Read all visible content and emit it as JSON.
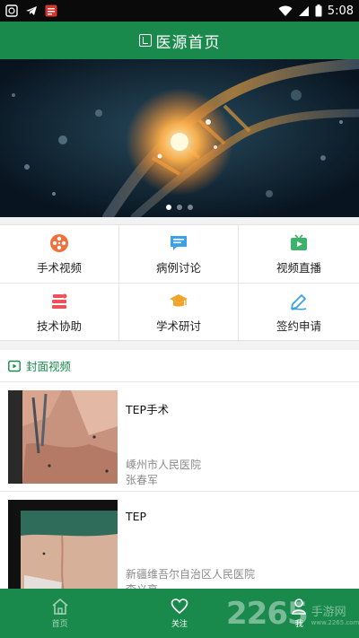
{
  "status_bar": {
    "time": "5:08",
    "icons": [
      "gallery-icon",
      "telegram-icon",
      "app-notification-icon",
      "wifi-icon",
      "signal-icon",
      "battery-icon"
    ]
  },
  "header": {
    "title": "医源首页"
  },
  "banner": {
    "slide_count": 3,
    "active_slide": 0
  },
  "features": [
    {
      "label": "手术视频",
      "icon": "film-reel-icon",
      "color": "#f0703c"
    },
    {
      "label": "病例讨论",
      "icon": "chat-bubble-icon",
      "color": "#3aa0e8"
    },
    {
      "label": "视频直播",
      "icon": "live-video-icon",
      "color": "#3cb26a"
    },
    {
      "label": "技术协助",
      "icon": "assist-stack-icon",
      "color": "#f0505a"
    },
    {
      "label": "学术研讨",
      "icon": "graduation-cap-icon",
      "color": "#f0a42a"
    },
    {
      "label": "签约申请",
      "icon": "signature-pen-icon",
      "color": "#3aa0e8"
    }
  ],
  "section": {
    "title": "封面视频",
    "icon": "video-play-icon"
  },
  "videos": [
    {
      "title": "TEP手术",
      "hospital": "嵊州市人民医院",
      "author": "张春军"
    },
    {
      "title": "TEP",
      "hospital": "新疆维吾尔自治区人民医院",
      "author": "李义亮"
    }
  ],
  "bottom_nav": [
    {
      "label": "首页",
      "icon": "home-icon",
      "active": true
    },
    {
      "label": "关注",
      "icon": "heart-icon",
      "active": false
    },
    {
      "label": "我",
      "icon": "person-icon",
      "active": false
    }
  ],
  "watermark": {
    "number": "2265",
    "text": "手游网",
    "url": "www.2265.com"
  },
  "colors": {
    "brand_green": "#1a8a4c",
    "section_green": "#1a8a4c"
  }
}
